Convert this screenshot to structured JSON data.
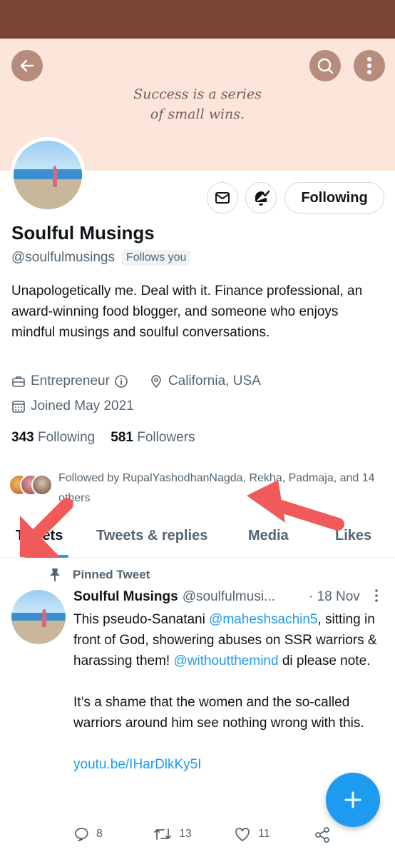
{
  "banner": {
    "quote_line1": "Success is a series",
    "quote_line2": "of small wins."
  },
  "profile": {
    "name": "Soulful Musings",
    "handle": "@soulfulmusings",
    "follows_you": "Follows you",
    "bio": "Unapologetically me. Deal with it. Finance professional, an award-winning food blogger, and someone who enjoys mindful musings and soulful conversations.",
    "profession": "Entrepreneur",
    "location": "California, USA",
    "joined": "Joined May 2021",
    "following_count": "343",
    "following_label": "Following",
    "followers_count": "581",
    "followers_label": "Followers",
    "followed_by": "Followed by RupalYashodhanNagda, Rekha, Padmaja, and 14 others"
  },
  "actions": {
    "following_button": "Following"
  },
  "tabs": [
    {
      "label": "Tweets"
    },
    {
      "label": "Tweets & replies"
    },
    {
      "label": "Media"
    },
    {
      "label": "Likes"
    }
  ],
  "tweet": {
    "pinned_label": "Pinned Tweet",
    "author_name": "Soulful Musings",
    "author_handle": "@soulfulmusi...",
    "date": "· 18 Nov",
    "text_1a": "This pseudo-Sanatani ",
    "mention_1": "@maheshsachin5",
    "text_1b": ", sitting in front of God, showering abuses on SSR warriors & harassing them! ",
    "mention_2": "@withoutthemind",
    "text_1c": " di please note.",
    "text_2": "It’s a shame that the women and the so-called warriors around him see nothing wrong with this.",
    "link": "youtu.be/IHarDlkKy5I",
    "replies": "8",
    "retweets": "13",
    "likes": "11"
  },
  "colors": {
    "accent": "#1d9bf0",
    "status_bar": "#7a4535",
    "banner_bg": "#fce6dc",
    "annotation_arrow": "#f05a5a"
  }
}
